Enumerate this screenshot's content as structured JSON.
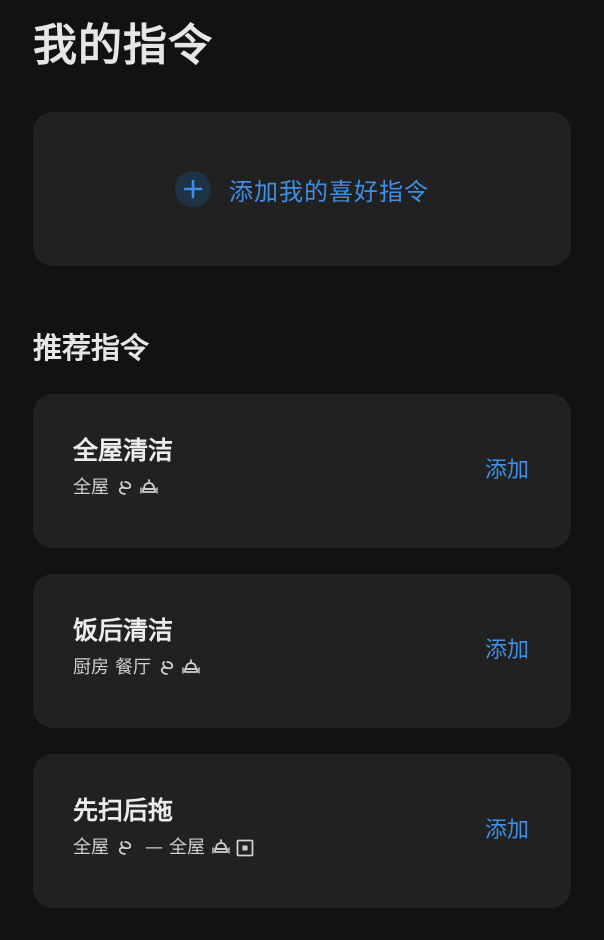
{
  "header": {
    "title": "我的指令"
  },
  "add_favorite": {
    "label": "添加我的喜好指令"
  },
  "recommended": {
    "title": "推荐指令",
    "items": [
      {
        "title": "全屋清洁",
        "rooms": [
          "全屋"
        ],
        "add_label": "添加"
      },
      {
        "title": "饭后清洁",
        "rooms": [
          "厨房",
          "餐厅"
        ],
        "add_label": "添加"
      },
      {
        "title": "先扫后拖",
        "step1_room": "全屋",
        "separator": "—",
        "step2_room": "全屋",
        "add_label": "添加"
      }
    ]
  },
  "colors": {
    "background": "#121212",
    "card": "#212121",
    "accent": "#3f8fe6"
  },
  "icons": [
    "sweep-icon",
    "mop-icon",
    "square-target-icon",
    "plus-icon"
  ]
}
